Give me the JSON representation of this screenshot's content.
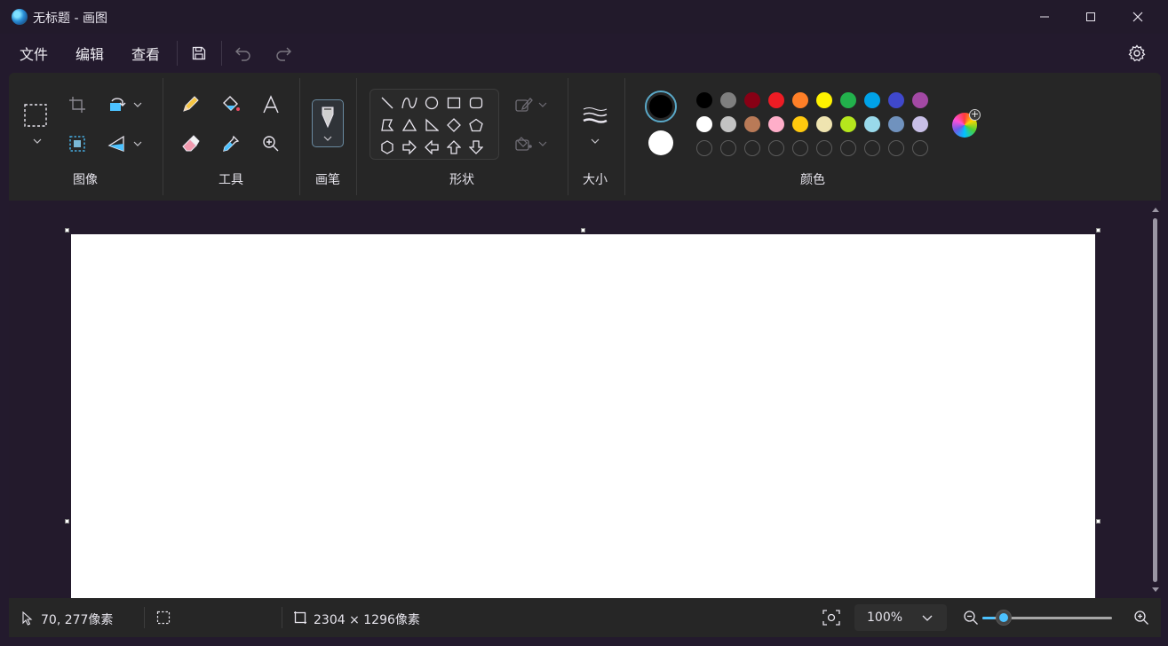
{
  "window": {
    "title": "无标题 - 画图"
  },
  "menu": {
    "file": "文件",
    "edit": "编辑",
    "view": "查看"
  },
  "ribbon": {
    "groups": {
      "image": "图像",
      "tools": "工具",
      "brushes": "画笔",
      "shapes": "形状",
      "size": "大小",
      "colors": "颜色"
    }
  },
  "colors": {
    "primary": "#000000",
    "secondary": "#ffffff",
    "palette_row1": [
      "#000000",
      "#7f7f7f",
      "#880015",
      "#ed1c24",
      "#ff7f27",
      "#fff200",
      "#22b14c",
      "#00a2e8",
      "#3f48cc",
      "#a349a4"
    ],
    "palette_row2": [
      "#ffffff",
      "#c3c3c3",
      "#b97a57",
      "#ffaec9",
      "#ffc90e",
      "#efe4b0",
      "#b5e61d",
      "#99d9ea",
      "#7092be",
      "#c8bfe7"
    ],
    "accent": "#4cc2ff"
  },
  "status": {
    "cursor_position": "70, 277像素",
    "canvas_size": "2304 × 1296像素",
    "zoom": "100%"
  }
}
